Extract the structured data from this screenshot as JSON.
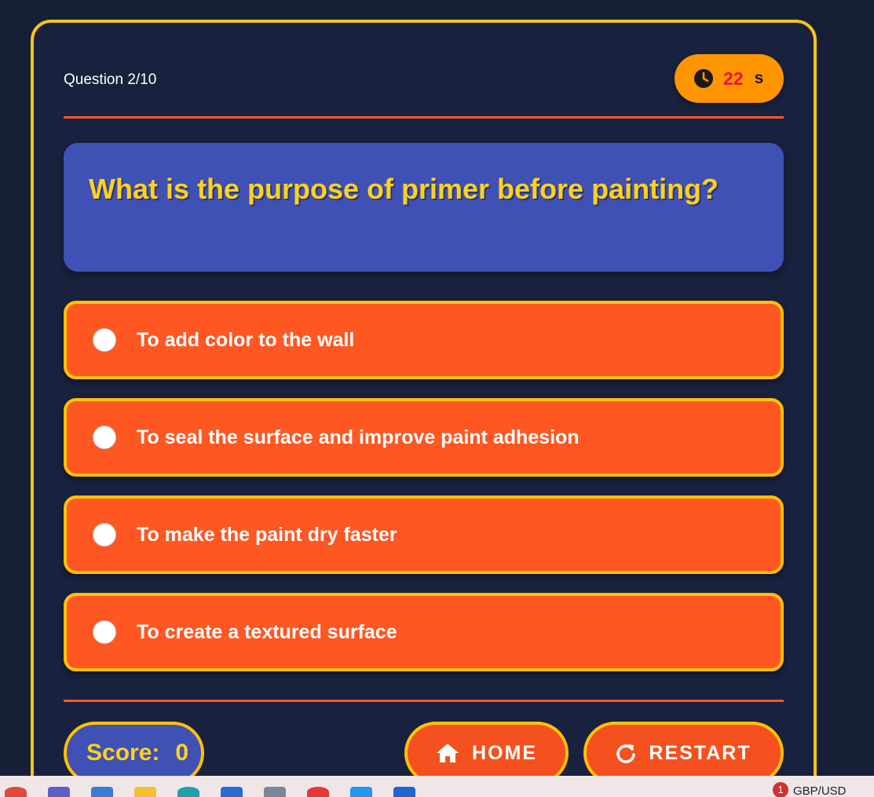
{
  "header": {
    "question_counter": "Question 2/10",
    "timer_value": "22",
    "timer_unit": "s"
  },
  "question": {
    "text": "What is the purpose of primer before painting?"
  },
  "options": [
    {
      "label": "To add color to the wall"
    },
    {
      "label": "To seal the surface and improve paint adhesion"
    },
    {
      "label": "To make the paint dry faster"
    },
    {
      "label": "To create a textured surface"
    }
  ],
  "footer": {
    "score_label": "Score:",
    "score_value": "0",
    "home_label": "HOME",
    "restart_label": "RESTART"
  },
  "taskbar": {
    "notification_count": "1",
    "widget_label": "GBP/USD"
  },
  "colors": {
    "background": "#18213d",
    "accent_border": "#ffc107",
    "option_bg": "#ff5722",
    "question_bg": "#3f51b5",
    "timer_bg": "#ff9500"
  }
}
